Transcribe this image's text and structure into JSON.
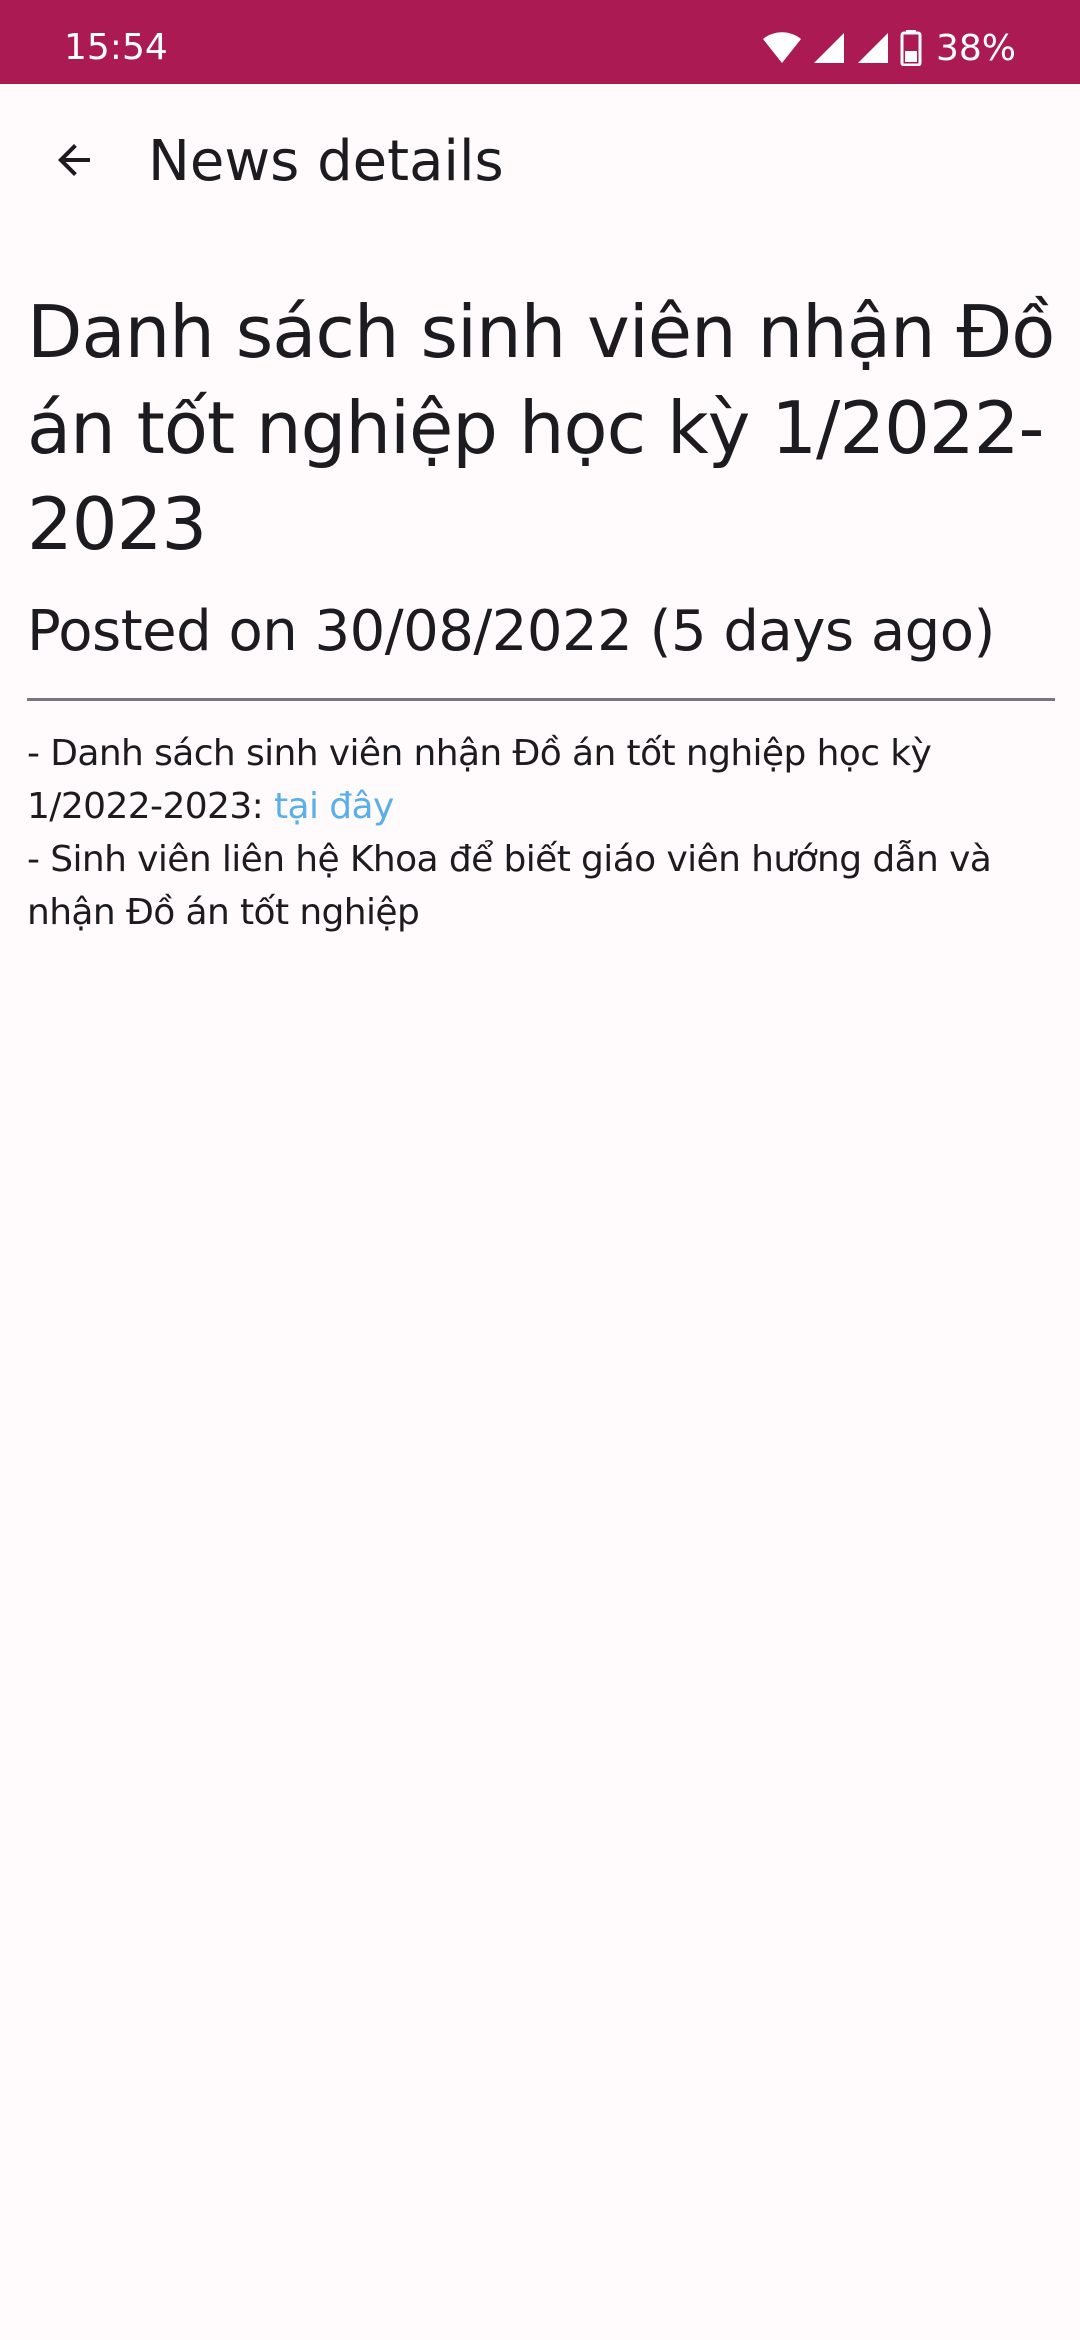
{
  "status_bar": {
    "time": "15:54",
    "battery": "38%",
    "icons": [
      "wifi-icon",
      "signal-icon",
      "signal-icon",
      "battery-icon"
    ],
    "background_color": "#ab1a52"
  },
  "app_bar": {
    "back_icon": "arrow-back-icon",
    "title": "News details"
  },
  "article": {
    "title": "Danh sách sinh viên nhận Đồ án tốt nghiệp học kỳ 1/2022-2023",
    "posted": "Posted on 30/08/2022 (5 days ago)",
    "body": {
      "line1_prefix": "- Danh sách sinh viên nhận Đồ án tốt nghiệp học kỳ 1/2022-2023: ",
      "line1_link": "tại đây",
      "line2": "- Sinh viên liên hệ Khoa để biết giáo viên hướng dẫn và nhận Đồ án tốt nghiệp"
    },
    "link_color": "#5aaeea"
  }
}
